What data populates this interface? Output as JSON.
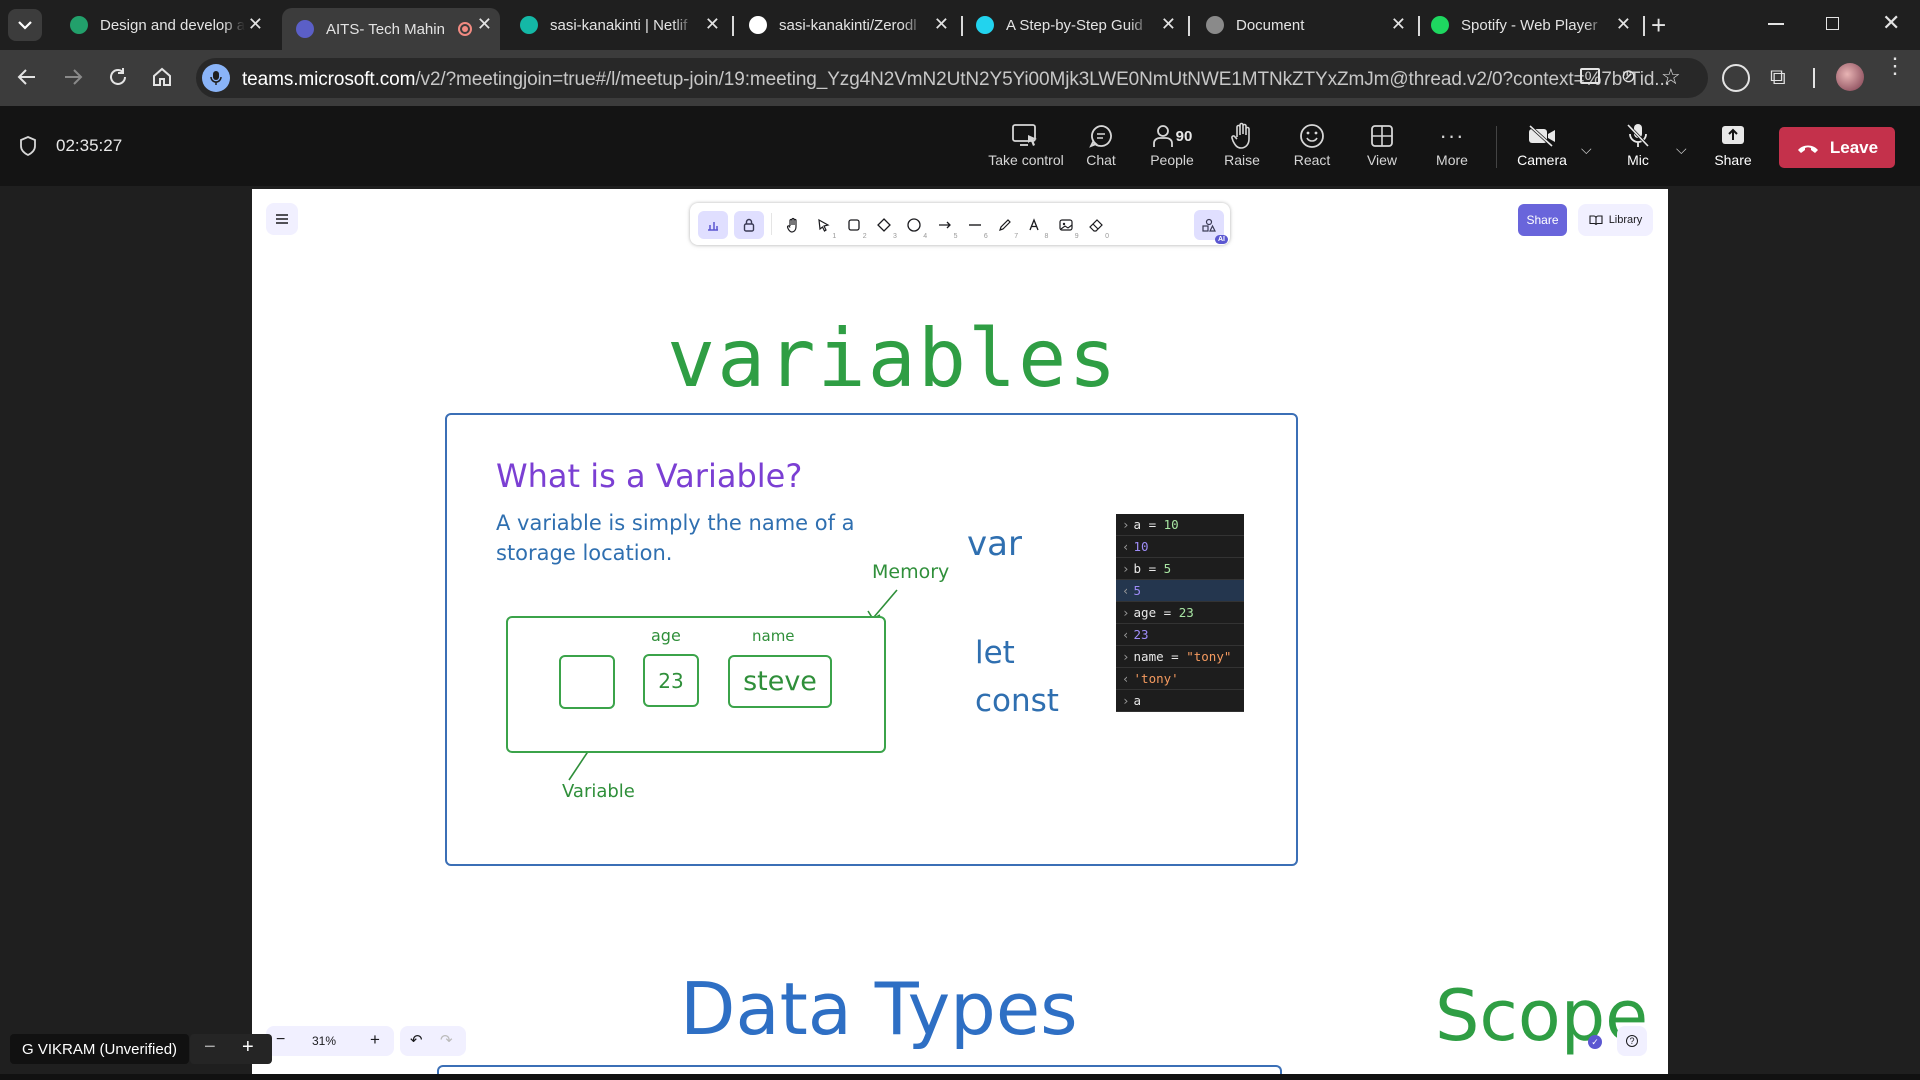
{
  "browser": {
    "tabs": [
      {
        "title": "Design and develop a",
        "favicon": "green-f-icon",
        "color": "#22a06b"
      },
      {
        "title": "AITS- Tech Mahin",
        "favicon": "teams-icon",
        "color": "#5b5fc7"
      },
      {
        "title": "sasi-kanakinti | Netlif",
        "favicon": "netlify-icon",
        "color": "#14b8a6"
      },
      {
        "title": "sasi-kanakinti/Zerodl",
        "favicon": "github-icon",
        "color": "#ffffff"
      },
      {
        "title": "A Step-by-Step Guid",
        "favicon": "sparkle-icon",
        "color": "#22d3ee"
      },
      {
        "title": "Document",
        "favicon": "globe-icon",
        "color": "#8a8a8a"
      },
      {
        "title": "Spotify - Web Player",
        "favicon": "spotify-icon",
        "color": "#1ed760"
      }
    ],
    "url_domain": "teams.microsoft.com",
    "url_path": "/v2/?meetingjoin=true#/l/meetup-join/19:meeting_Yzg4N2VmN2UtN2Y5Yi00Mjk3LWE0NmUtNWE1MTNkZTYxZmJm@thread.v2/0?context=%7b\"Tid..."
  },
  "meeting": {
    "timer": "02:35:27",
    "controls": {
      "take_control": "Take control",
      "chat": "Chat",
      "people": "People",
      "people_count": "90",
      "raise": "Raise",
      "react": "React",
      "view": "View",
      "more": "More",
      "camera": "Camera",
      "mic": "Mic",
      "share": "Share",
      "leave": "Leave"
    },
    "participant_name": "G VIKRAM (Unverified)"
  },
  "whiteboard": {
    "share_label": "Share",
    "library_label": "Library",
    "zoom": "31%",
    "tools": [
      {
        "name": "hand-tool",
        "key": ""
      },
      {
        "name": "selection-tool",
        "key": "1"
      },
      {
        "name": "rectangle-tool",
        "key": "2"
      },
      {
        "name": "diamond-tool",
        "key": "3"
      },
      {
        "name": "ellipse-tool",
        "key": "4"
      },
      {
        "name": "arrow-tool",
        "key": "5"
      },
      {
        "name": "line-tool",
        "key": "6"
      },
      {
        "name": "draw-tool",
        "key": "7"
      },
      {
        "name": "text-tool",
        "key": "8"
      },
      {
        "name": "image-tool",
        "key": "9"
      },
      {
        "name": "eraser-tool",
        "key": "0"
      }
    ],
    "ai_badge": "AI",
    "heading": "variables",
    "card": {
      "title": "What is a Variable?",
      "definition_line1": "A variable is simply the name of a",
      "definition_line2": "storage location.",
      "memory_label": "Memory",
      "label_age": "age",
      "label_name": "name",
      "value_age": "23",
      "value_name": "steve",
      "variable_label": "Variable",
      "keyword_var": "var",
      "keyword_let": "let",
      "keyword_const": "const",
      "console": [
        {
          "dir": "in",
          "code": "a = ",
          "val": "10",
          "type": "num"
        },
        {
          "dir": "out",
          "code": "",
          "val": "10",
          "type": "num"
        },
        {
          "dir": "in",
          "code": "b = ",
          "val": "5",
          "type": "num"
        },
        {
          "dir": "out",
          "code": "",
          "val": "5",
          "type": "num"
        },
        {
          "dir": "in",
          "code": "age = ",
          "val": "23",
          "type": "num"
        },
        {
          "dir": "out",
          "code": "",
          "val": "23",
          "type": "num"
        },
        {
          "dir": "in",
          "code": "name = ",
          "val": "\"tony\"",
          "type": "str"
        },
        {
          "dir": "out",
          "code": "",
          "val": "'tony'",
          "type": "str"
        },
        {
          "dir": "in",
          "code": "a",
          "val": "",
          "type": "num"
        }
      ]
    },
    "heading_data_types": "Data Types",
    "heading_scope": "Scope"
  }
}
